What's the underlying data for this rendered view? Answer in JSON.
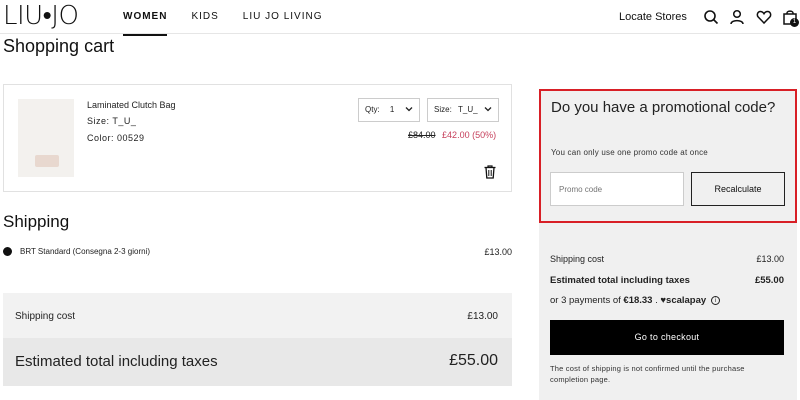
{
  "header": {
    "logo": "LIU•JO",
    "nav": [
      "WOMEN",
      "KIDS",
      "LIU JO LIVING"
    ],
    "locate_stores": "Locate Stores",
    "bag_count": "1"
  },
  "page": {
    "title": "Shopping cart"
  },
  "product": {
    "name": "Laminated Clutch Bag",
    "size": "Size: T_U_",
    "color": "Color: 00529",
    "qty_label": "Qty:",
    "qty_value": "1",
    "size_select_label": "Size:",
    "size_select_value": "T_U_",
    "old_price": "£84.00",
    "new_price": "£42.00 (50%)"
  },
  "shipping": {
    "title": "Shipping",
    "option_name": "BRT Standard (Consegna 2-3 giorni)",
    "option_price": "£13.00"
  },
  "summary_left": {
    "shipping_label": "Shipping cost",
    "shipping_value": "£13.00",
    "total_label": "Estimated total including taxes",
    "total_value": "£55.00"
  },
  "promo": {
    "title": "Do you have a promotional code?",
    "subtitle": "You can only use one promo code at once",
    "placeholder": "Promo code",
    "button": "Recalculate"
  },
  "summary_right": {
    "shipping_label": "Shipping cost",
    "shipping_value": "£13.00",
    "total_label": "Estimated total including taxes",
    "total_value": "£55.00",
    "payments_prefix": "or 3 payments of",
    "payments_amount": "€18.33",
    "payments_sep": ".",
    "scalapay_brand": "scalapay",
    "checkout_button": "Go to checkout",
    "note": "The cost of shipping is not confirmed until the purchase completion page."
  },
  "colors": {
    "accent_red": "#d81f26",
    "sale_pink": "#c6405c",
    "checkout_black": "#000000"
  }
}
